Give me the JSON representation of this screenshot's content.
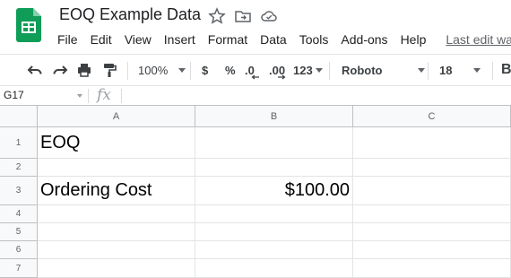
{
  "document": {
    "title": "EOQ Example Data",
    "last_edit": "Last edit was"
  },
  "header_icons": [
    "star-icon",
    "move-to-folder-icon",
    "cloud-status-icon"
  ],
  "menu": [
    "File",
    "Edit",
    "View",
    "Insert",
    "Format",
    "Data",
    "Tools",
    "Add-ons",
    "Help"
  ],
  "toolbar": {
    "zoom": "100%",
    "currency": "$",
    "percent": "%",
    "decrease_decimals": ".0",
    "increase_decimals": ".00",
    "more_formats": "123",
    "font": "Roboto",
    "font_size": "18",
    "bold": "B"
  },
  "formula_bar": {
    "name_box": "G17",
    "fx": "fx",
    "value": ""
  },
  "sheet": {
    "columns": [
      "A",
      "B",
      "C"
    ],
    "rows": [
      "1",
      "2",
      "3",
      "4",
      "5",
      "6",
      "7"
    ],
    "cells": {
      "A1": "EOQ",
      "A3": "Ordering Cost",
      "B3": "$100.00"
    }
  },
  "colors": {
    "sheets_green": "#0f9d58",
    "header_bg": "#f8f9fa",
    "gridline": "#e2e3e3"
  }
}
